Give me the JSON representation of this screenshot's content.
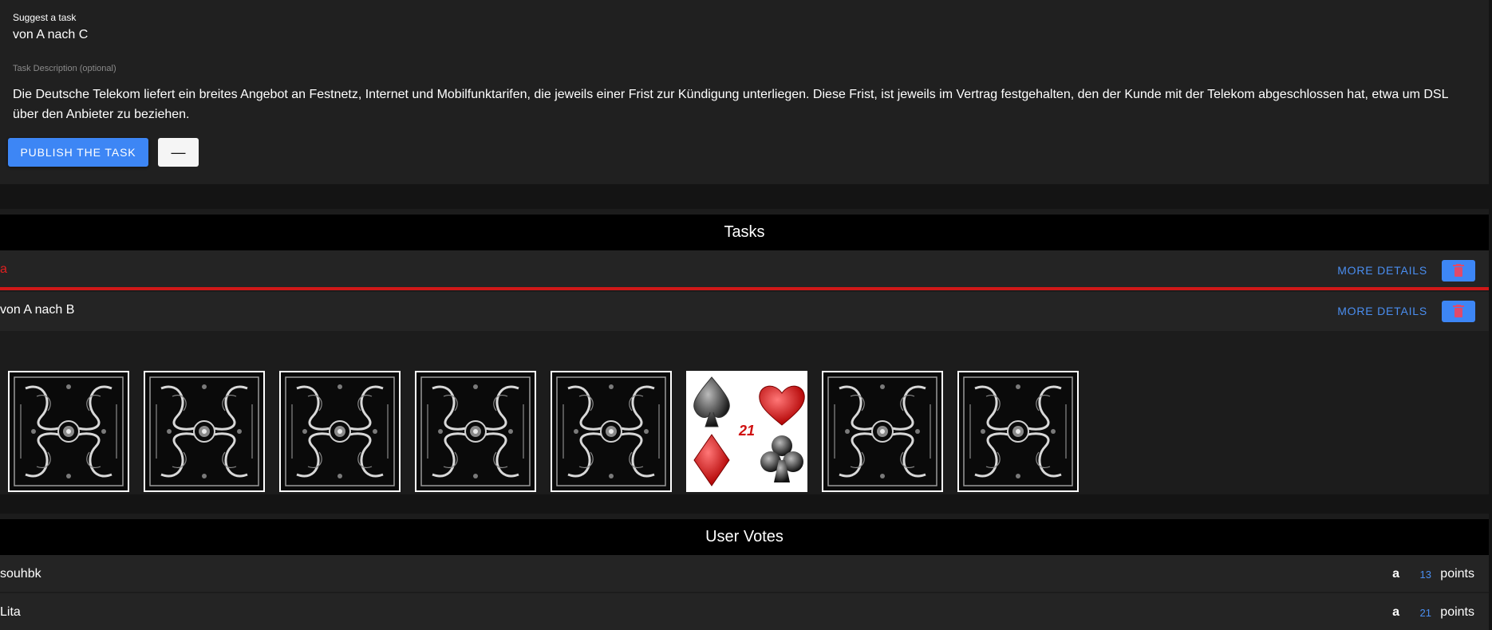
{
  "suggest": {
    "label": "Suggest a task",
    "task_name": "von A nach C",
    "description_label": "Task Description (optional)",
    "description": "Die Deutsche Telekom liefert ein breites Angebot an Festnetz, Internet und Mobilfunktarifen, die jeweils einer Frist zur Kündigung unterliegen. Diese Frist, ist jeweils im Vertrag festgehalten, den der Kunde mit der Telekom abgeschlossen hat, etwa um DSL über den Anbieter zu beziehen.",
    "publish_label": "PUBLISH THE TASK",
    "minus_label": "—"
  },
  "tasks": {
    "title": "Tasks",
    "items": [
      {
        "title": "a",
        "more_label": "MORE DETAILS",
        "active": true
      },
      {
        "title": "von A nach B",
        "more_label": "MORE DETAILS",
        "active": false
      }
    ]
  },
  "cards": {
    "center_label": "21",
    "items": [
      "card-back",
      "card-back",
      "card-back",
      "card-back",
      "card-back",
      "card-face-suits",
      "card-back",
      "card-back"
    ]
  },
  "votes": {
    "title": "User Votes",
    "items": [
      {
        "user": "souhbk",
        "task": "a",
        "points": "13",
        "points_label": "points"
      },
      {
        "user": "Lita",
        "task": "a",
        "points": "21",
        "points_label": "points"
      }
    ]
  },
  "colors": {
    "accent": "#3d86f5",
    "active_task": "#e02020",
    "delete_icon": "#e04a6a",
    "panel": "#202020",
    "header": "#000000"
  }
}
